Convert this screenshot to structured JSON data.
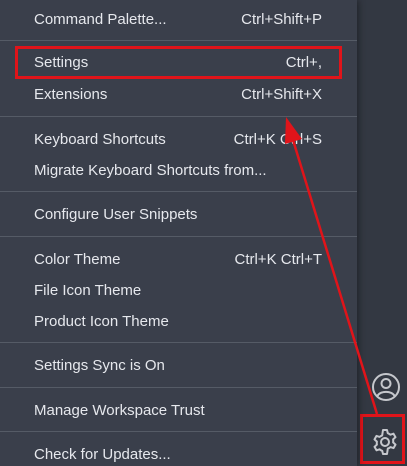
{
  "menu": {
    "items": [
      {
        "label": "Command Palette...",
        "keys": "Ctrl+Shift+P"
      },
      {
        "label": "Settings",
        "keys": "Ctrl+,"
      },
      {
        "label": "Extensions",
        "keys": "Ctrl+Shift+X"
      },
      {
        "label": "Keyboard Shortcuts",
        "keys": "Ctrl+K Ctrl+S"
      },
      {
        "label": "Migrate Keyboard Shortcuts from...",
        "keys": ""
      },
      {
        "label": "Configure User Snippets",
        "keys": ""
      },
      {
        "label": "Color Theme",
        "keys": "Ctrl+K Ctrl+T"
      },
      {
        "label": "File Icon Theme",
        "keys": ""
      },
      {
        "label": "Product Icon Theme",
        "keys": ""
      },
      {
        "label": "Settings Sync is On",
        "keys": ""
      },
      {
        "label": "Manage Workspace Trust",
        "keys": ""
      },
      {
        "label": "Check for Updates...",
        "keys": ""
      }
    ]
  },
  "activity_bar": {
    "icons": [
      "account-icon",
      "gear-icon"
    ]
  },
  "colors": {
    "menu_bg": "#3a3f4b",
    "activity_bg": "#333842",
    "text": "#e6e8ed",
    "highlight": "#e0141a"
  }
}
